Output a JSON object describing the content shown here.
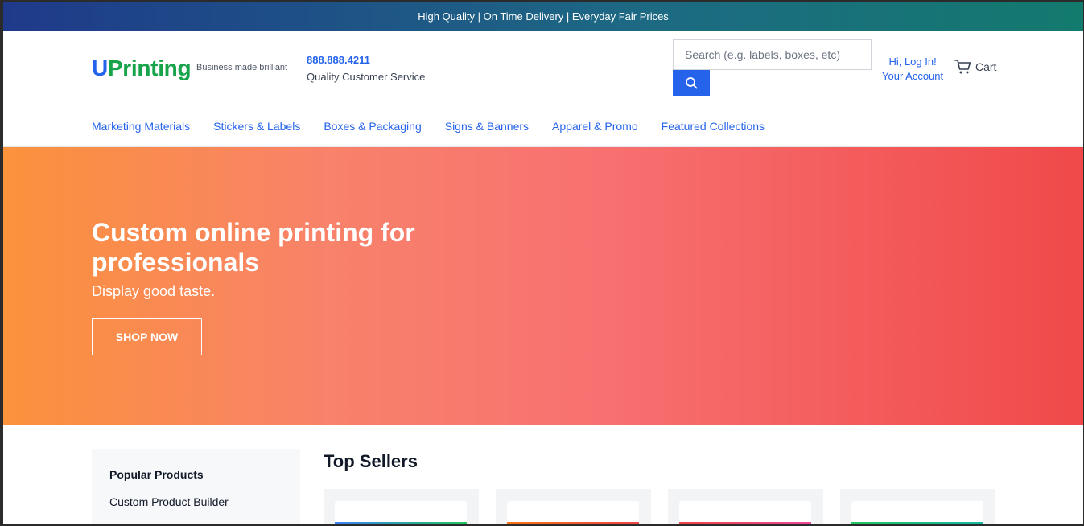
{
  "promo_bar": {
    "text": "High Quality | On Time Delivery | Everyday Fair Prices"
  },
  "header": {
    "logo_u": "U",
    "logo_rest": "Printing",
    "tagline": "Business made brilliant",
    "phone": "888.888.4211",
    "phone_sub": "Quality Customer Service",
    "search": {
      "placeholder": "Search (e.g. labels, boxes, etc)",
      "value": "",
      "button_icon": "search-icon"
    },
    "account": {
      "line1": "Hi, Log In!",
      "line2": "Your Account"
    },
    "cart": {
      "label": "Cart",
      "icon": "cart-icon"
    }
  },
  "nav": {
    "items": [
      {
        "label": "Marketing Materials"
      },
      {
        "label": "Stickers & Labels"
      },
      {
        "label": "Boxes & Packaging"
      },
      {
        "label": "Signs & Banners"
      },
      {
        "label": "Apparel & Promo"
      },
      {
        "label": "Featured Collections"
      }
    ]
  },
  "hero": {
    "title": "Custom online printing for professionals",
    "subtitle": "Display good taste.",
    "button": "SHOP NOW"
  },
  "sidebar": {
    "title": "Popular Products",
    "items": [
      {
        "label": "Custom Product Builder"
      }
    ]
  },
  "top_sellers": {
    "title": "Top Sellers",
    "card_colors": [
      [
        "#3b82f6",
        "#22c55e"
      ],
      [
        "#f97316",
        "#ef4444"
      ],
      [
        "#ef4444",
        "#ec4899"
      ],
      [
        "#22c55e",
        "#14b8a6"
      ]
    ]
  },
  "colors": {
    "brand_blue": "#2563eb",
    "brand_green": "#16a34a"
  }
}
